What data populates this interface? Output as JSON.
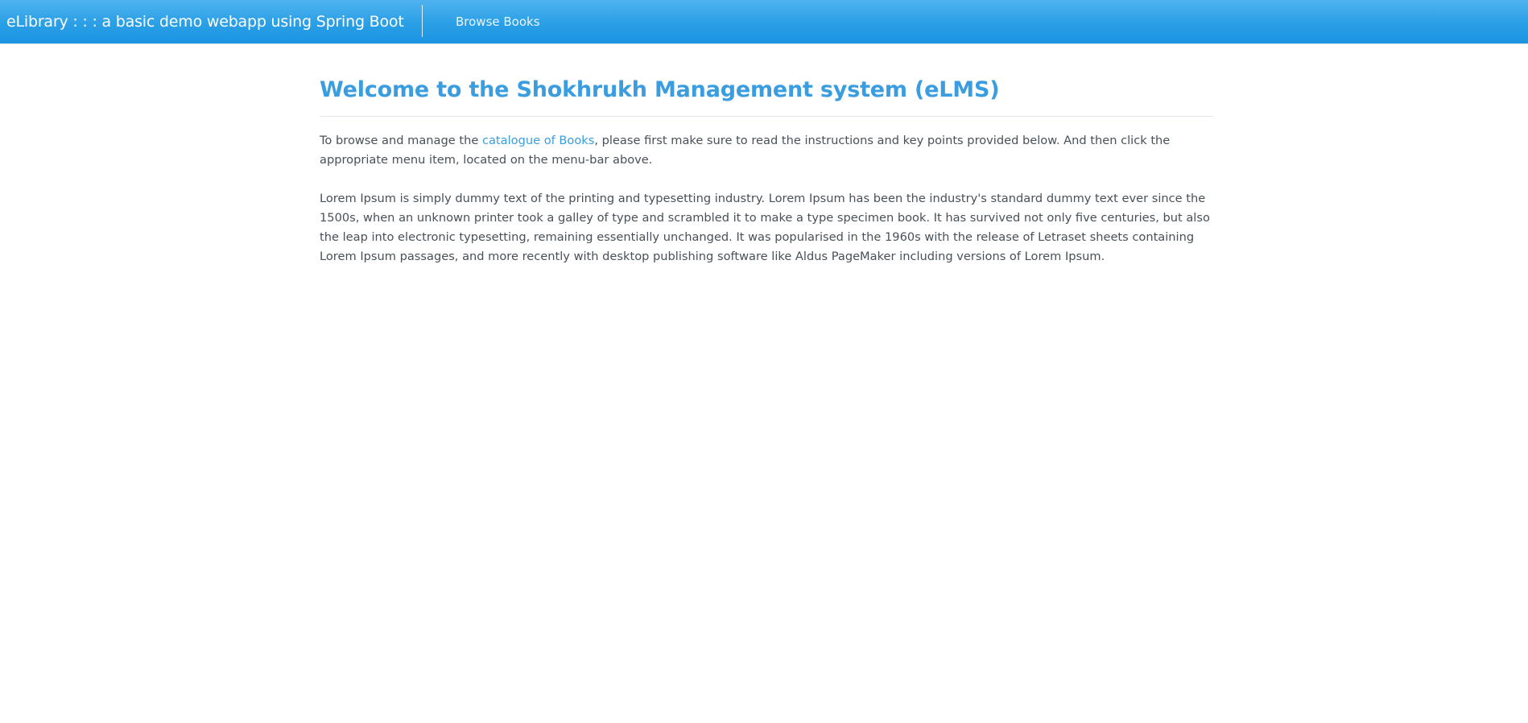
{
  "navbar": {
    "brand": "eLibrary : : : a basic demo webapp using Spring Boot",
    "links": [
      {
        "label": "Browse Books"
      }
    ]
  },
  "main": {
    "title": "Welcome to the Shokhrukh Management system (eLMS)",
    "intro": {
      "before": "To browse and manage the ",
      "link_label": "catalogue of Books",
      "after": ", please first make sure to read the instructions and key points provided below. And then click the appropriate menu item, located on the menu-bar above."
    },
    "lorem": "Lorem Ipsum is simply dummy text of the printing and typesetting industry. Lorem Ipsum has been the industry's standard dummy text ever since the 1500s, when an unknown printer took a galley of type and scrambled it to make a type specimen book. It has survived not only five centuries, but also the leap into electronic typesetting, remaining essentially unchanged. It was popularised in the 1960s with the release of Letraset sheets containing Lorem Ipsum passages, and more recently with desktop publishing software like Aldus PageMaker including versions of Lorem Ipsum."
  },
  "colors": {
    "navbar_top": "#4fb3ee",
    "navbar_bottom": "#1c94e2",
    "accent": "#3a9de0",
    "body_text": "#495057"
  }
}
